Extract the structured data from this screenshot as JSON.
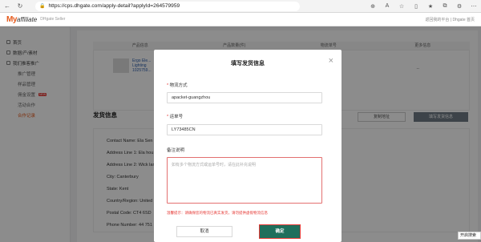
{
  "browser": {
    "url": "https://cps.dhgate.com/apply-detail?applyId=264579959"
  },
  "header": {
    "logo_my": "My",
    "logo_affiliate": "affiliate",
    "logo_sub": "DHgate Seller",
    "right_text": "返回我的平台 | Dhgate 首页"
  },
  "sidebar": {
    "items": [
      {
        "label": "首页"
      },
      {
        "label": "数据/产/素材"
      },
      {
        "label": "我们推客推广"
      },
      {
        "label": "推广管理"
      },
      {
        "label": "样品管理"
      },
      {
        "label": "佣金设置",
        "badge": "NEW"
      },
      {
        "label": "活动合作"
      },
      {
        "label": "合作记录"
      }
    ]
  },
  "background": {
    "table_headers": [
      "产品信息",
      "产品数量(件)",
      "物流单号",
      "更多信息"
    ],
    "product_name": "Ergo Ele... Lighting 1025759...",
    "dash": "--",
    "section_title": "发货信息",
    "btn_copy": "复制地址",
    "btn_fill": "填写发货信息",
    "address_lines": [
      "Contact Name: Ela Sen",
      "Address Line 1: Ela hou",
      "Address Line 2: Wick lan",
      "City: Canterbury",
      "State: Kent",
      "Country/Region: United",
      "Postal Code: CT4 6SD",
      "Phone Number: 44 751"
    ]
  },
  "modal": {
    "title": "填写发货信息",
    "close": "×",
    "shipping_method_label": "物流方式",
    "shipping_method_value": "apacket-guangzhou",
    "tracking_label": "运单号",
    "tracking_value": "LY73485CN",
    "remark_label": "备注说明",
    "remark_placeholder": "如有多个物流方式或运单号时，请在此补充说明",
    "warning": "温馨提示：请确保您的物流已真实发货，请勿提供虚假物流信息",
    "cancel": "取消",
    "confirm": "确定"
  },
  "tooltip": "开启搜索"
}
